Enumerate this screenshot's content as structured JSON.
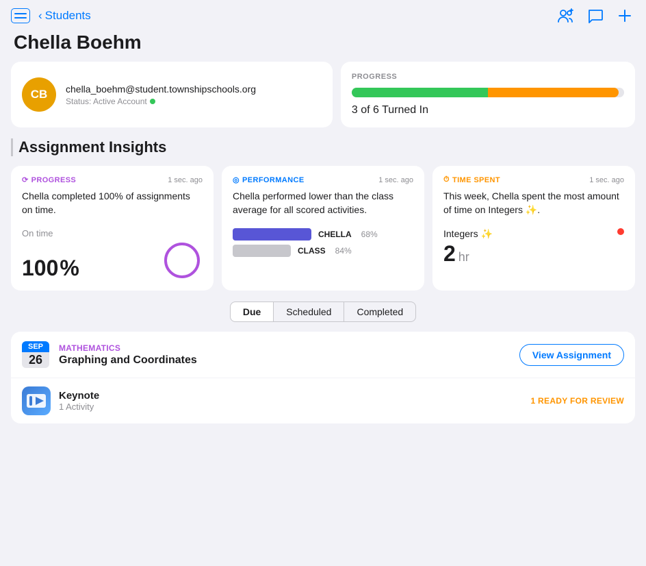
{
  "topBar": {
    "back_label": "Students",
    "icons": {
      "person_group": "👥",
      "message": "💬",
      "add": "+"
    }
  },
  "student": {
    "name": "Chella Boehm",
    "initials": "CB",
    "email": "chella_boehm@student.townshipschools.org",
    "status_label": "Status: Active Account",
    "avatar_color": "#e8a000"
  },
  "progress": {
    "label": "PROGRESS",
    "turned_in_text": "3 of 6 Turned In",
    "green_pct": 50,
    "orange_pct": 48
  },
  "sectionTitle": "Assignment Insights",
  "insightCards": [
    {
      "tag": "PROGRESS",
      "tag_type": "progress",
      "tag_icon": "⟳",
      "timestamp": "1 sec. ago",
      "description": "Chella completed 100% of assignments on time.",
      "metric_label": "On time",
      "metric_value": "100",
      "metric_unit": "%"
    },
    {
      "tag": "PERFORMANCE",
      "tag_type": "performance",
      "tag_icon": "◎",
      "timestamp": "1 sec. ago",
      "description": "Chella performed lower than the class average for all scored activities.",
      "chella_pct": "68%",
      "class_pct": "84%",
      "chella_bar_label": "CHELLA",
      "class_bar_label": "CLASS"
    },
    {
      "tag": "TIME SPENT",
      "tag_type": "time-spent",
      "tag_icon": "⏱",
      "timestamp": "1 sec. ago",
      "description": "This week, Chella spent the most amount of time on Integers ✨.",
      "topic": "Integers ✨",
      "time_value": "2",
      "time_unit": "hr"
    }
  ],
  "filterTabs": [
    {
      "label": "Due",
      "active": true
    },
    {
      "label": "Scheduled",
      "active": false
    },
    {
      "label": "Completed",
      "active": false
    }
  ],
  "assignments": [
    {
      "month": "SEP",
      "day": "26",
      "subject": "MATHEMATICS",
      "title": "Graphing and Coordinates",
      "view_btn_label": "View Assignment",
      "items": [
        {
          "icon_type": "keynote",
          "name": "Keynote",
          "subtitle": "1 Activity",
          "status": "1 READY FOR REVIEW"
        }
      ]
    }
  ]
}
